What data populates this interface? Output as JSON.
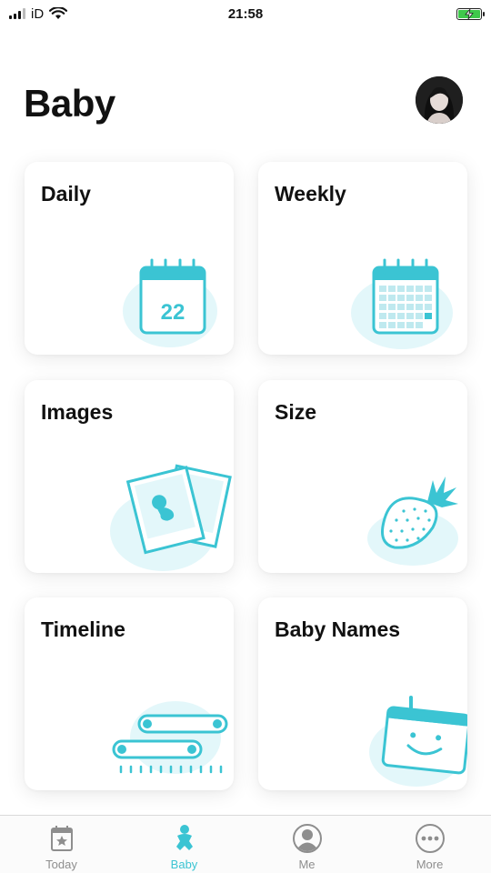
{
  "status_bar": {
    "carrier": "iD",
    "time": "21:58"
  },
  "header": {
    "title": "Baby"
  },
  "cards": {
    "daily": {
      "title": "Daily",
      "day_number": "22",
      "icon": "calendar-day-icon"
    },
    "weekly": {
      "title": "Weekly",
      "icon": "calendar-week-icon"
    },
    "images": {
      "title": "Images",
      "icon": "ultrasound-photos-icon"
    },
    "size": {
      "title": "Size",
      "icon": "strawberry-icon"
    },
    "timeline": {
      "title": "Timeline",
      "icon": "timeline-icon"
    },
    "names": {
      "title": "Baby Names",
      "icon": "name-tag-icon"
    }
  },
  "tab_bar": {
    "active": "Baby",
    "tabs": [
      {
        "label": "Today",
        "icon": "calendar-star-icon"
      },
      {
        "label": "Baby",
        "icon": "baby-icon"
      },
      {
        "label": "Me",
        "icon": "person-icon"
      },
      {
        "label": "More",
        "icon": "more-dots-icon"
      }
    ]
  },
  "colors": {
    "accent": "#3bc4d3",
    "accent_light": "#e3f7fa",
    "inactive": "#8e8e8e"
  }
}
